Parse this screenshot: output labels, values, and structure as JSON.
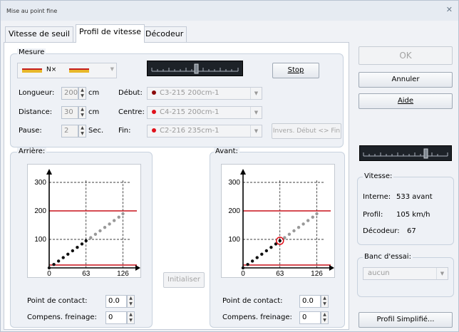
{
  "window": {
    "title": "Mise au point fine",
    "close_glyph": "✕"
  },
  "tabs": [
    "Vitesse de seuil",
    "Profil de vitesse",
    "Décodeur"
  ],
  "mesure": {
    "label": "Mesure",
    "stop_label": "Stop",
    "longueur": {
      "label": "Longueur:",
      "value": "200",
      "unit": "cm"
    },
    "distance": {
      "label": "Distance:",
      "value": "30",
      "unit": "cm"
    },
    "pause": {
      "label": "Pause:",
      "value": "2",
      "unit": "Sec."
    },
    "debut": {
      "label": "Début:",
      "value": "C3-215 200cm-1",
      "color": "#8b0a0a"
    },
    "centre": {
      "label": "Centre:",
      "value": "C4-215 200cm-1",
      "color": "#e0111b"
    },
    "fin": {
      "label": "Fin:",
      "value": "C2-216 235cm-1",
      "color": "#e0111b"
    },
    "invers_label": "Invers. Début <> Fin",
    "train_text": "N×"
  },
  "arriere": {
    "label": "Arrière:",
    "contact_label": "Point de contact:",
    "contact_value": "0.0",
    "frein_label": "Compens. freinage:",
    "frein_value": "0"
  },
  "avant": {
    "label": "Avant:",
    "contact_label": "Point de contact:",
    "contact_value": "0.0",
    "frein_label": "Compens. freinage:",
    "frein_value": "0"
  },
  "initialiser_label": "Initialiser",
  "buttons": {
    "ok": "OK",
    "annuler": "Annuler",
    "aide": "Aide",
    "profil": "Profil Simplifié..."
  },
  "vitesse": {
    "label": "Vitesse:",
    "interne_label": "Interne:",
    "interne_value": "533 avant",
    "profil_label": "Profil:",
    "profil_value": "105 km/h",
    "decodeur_label": "Décodeur:",
    "decodeur_value": "67"
  },
  "banc": {
    "label": "Banc d'essai:",
    "value": "aucun"
  },
  "chart_data": [
    {
      "type": "scatter",
      "title": "Arrière",
      "x": [
        0,
        8,
        16,
        24,
        32,
        40,
        48,
        56,
        63,
        71,
        79,
        87,
        95,
        103,
        111,
        119,
        126
      ],
      "y": [
        0,
        12,
        24,
        36,
        48,
        60,
        72,
        84,
        95,
        106,
        118,
        130,
        142,
        154,
        166,
        178,
        190
      ],
      "ylim": [
        0,
        330
      ],
      "xticks": [
        0,
        63,
        126
      ],
      "yticks": [
        100,
        200,
        300
      ],
      "hlines": [
        200,
        0
      ],
      "highlight": null
    },
    {
      "type": "scatter",
      "title": "Avant",
      "x": [
        0,
        8,
        16,
        24,
        32,
        40,
        48,
        56,
        63,
        71,
        79,
        87,
        95,
        103,
        111,
        119,
        126
      ],
      "y": [
        0,
        12,
        24,
        36,
        48,
        60,
        72,
        84,
        95,
        106,
        118,
        130,
        142,
        154,
        166,
        178,
        190
      ],
      "ylim": [
        0,
        330
      ],
      "xticks": [
        0,
        63,
        126
      ],
      "yticks": [
        100,
        200,
        300
      ],
      "hlines": [
        200,
        0
      ],
      "highlight": 8
    }
  ]
}
